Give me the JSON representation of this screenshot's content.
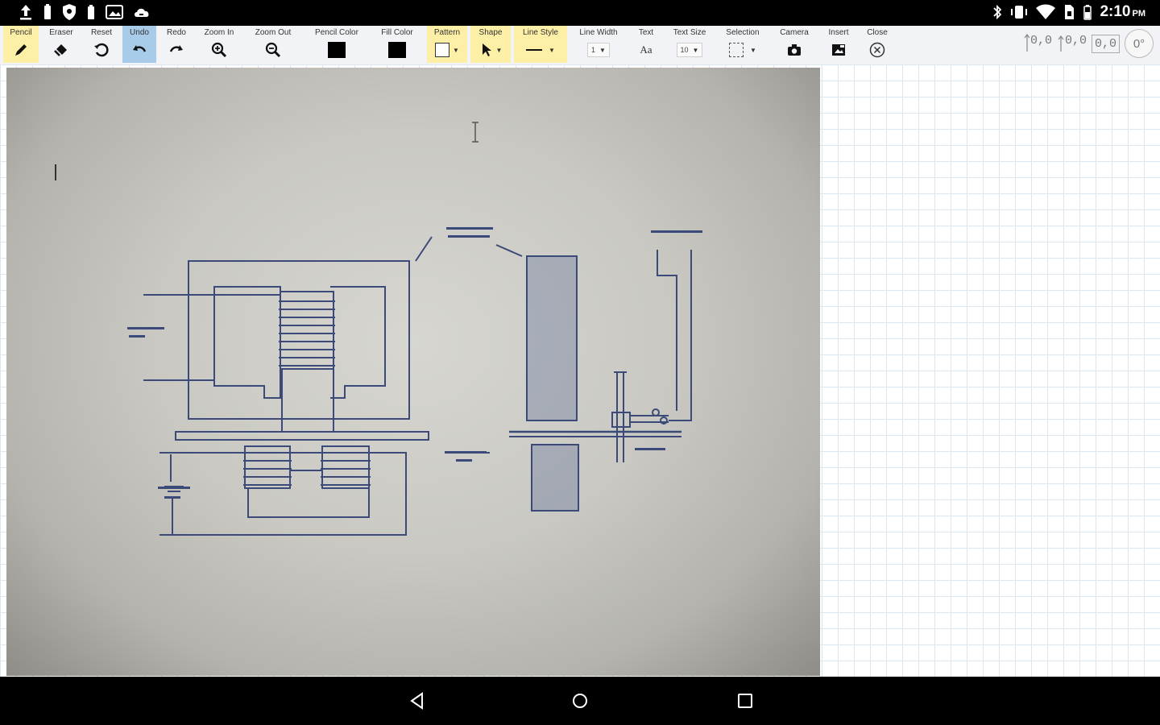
{
  "status_bar": {
    "time": "2:10",
    "ampm": "PM"
  },
  "toolbar": {
    "items": [
      {
        "label": "Pencil",
        "icon": "pencil-icon"
      },
      {
        "label": "Eraser",
        "icon": "eraser-icon"
      },
      {
        "label": "Reset",
        "icon": "reset-icon"
      },
      {
        "label": "Undo",
        "icon": "undo-icon"
      },
      {
        "label": "Redo",
        "icon": "redo-icon"
      },
      {
        "label": "Zoom In",
        "icon": "zoom-in-icon"
      },
      {
        "label": "Zoom Out",
        "icon": "zoom-out-icon"
      },
      {
        "label": "Pencil Color",
        "icon": "pencil-color-swatch"
      },
      {
        "label": "Fill Color",
        "icon": "fill-color-swatch"
      },
      {
        "label": "Pattern",
        "icon": "pattern-icon"
      },
      {
        "label": "Shape",
        "icon": "shape-icon"
      },
      {
        "label": "Line Style",
        "icon": "line-style-icon"
      },
      {
        "label": "Line Width",
        "icon": "line-width-select"
      },
      {
        "label": "Text",
        "icon": "text-icon"
      },
      {
        "label": "Text Size",
        "icon": "text-size-select"
      },
      {
        "label": "Selection",
        "icon": "selection-icon"
      },
      {
        "label": "Camera",
        "icon": "camera-icon"
      },
      {
        "label": "Insert",
        "icon": "insert-image-icon"
      },
      {
        "label": "Close",
        "icon": "close-icon"
      }
    ],
    "line_width_value": "1",
    "text_size_value": "10",
    "text_glyph": "Aa",
    "pencil_color": "#000000",
    "fill_color": "#000000"
  },
  "coords": {
    "x": "0,0",
    "y": "0,0",
    "size": "0,0",
    "angle": "0°"
  },
  "colors": {
    "active_yellow": "#fdf0a6",
    "active_blue": "#a7cbe9",
    "toolbar_bg": "#f2f3f6",
    "sketch_ink": "#3b4a78"
  }
}
